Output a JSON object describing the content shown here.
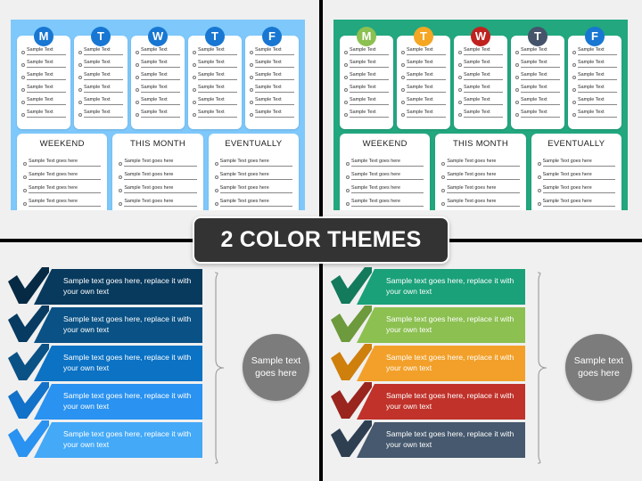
{
  "banner": {
    "title": "2 COLOR THEMES"
  },
  "theme_blue": {
    "panel_color": "#7ec8fb",
    "days": [
      {
        "letter": "M",
        "badge_color": "#1877d2",
        "tasks": [
          "Sample Text",
          "Sample Text",
          "Sample Text",
          "Sample Text",
          "Sample Text",
          "Sample Text"
        ]
      },
      {
        "letter": "T",
        "badge_color": "#1877d2",
        "tasks": [
          "Sample Text",
          "Sample Text",
          "Sample Text",
          "Sample Text",
          "Sample Text",
          "Sample Text"
        ]
      },
      {
        "letter": "W",
        "badge_color": "#1877d2",
        "tasks": [
          "Sample Text",
          "Sample Text",
          "Sample Text",
          "Sample Text",
          "Sample Text",
          "Sample Text"
        ]
      },
      {
        "letter": "T",
        "badge_color": "#1877d2",
        "tasks": [
          "Sample Text",
          "Sample Text",
          "Sample Text",
          "Sample Text",
          "Sample Text",
          "Sample Text"
        ]
      },
      {
        "letter": "F",
        "badge_color": "#1877d2",
        "tasks": [
          "Sample Text",
          "Sample Text",
          "Sample Text",
          "Sample Text",
          "Sample Text",
          "Sample Text"
        ]
      }
    ],
    "buckets": [
      {
        "title": "WEEKEND",
        "tasks": [
          "Sample Text goes here",
          "Sample Text goes here",
          "Sample Text goes here",
          "Sample Text goes here"
        ]
      },
      {
        "title": "THIS MONTH",
        "tasks": [
          "Sample Text goes here",
          "Sample Text goes here",
          "Sample Text goes here",
          "Sample Text goes here"
        ]
      },
      {
        "title": "EVENTUALLY",
        "tasks": [
          "Sample Text goes here",
          "Sample Text goes here",
          "Sample Text goes here",
          "Sample Text goes here"
        ]
      }
    ]
  },
  "theme_green": {
    "panel_color": "#22a77f",
    "days": [
      {
        "letter": "M",
        "badge_color": "#8cc051",
        "tasks": [
          "Sample Text",
          "Sample Text",
          "Sample Text",
          "Sample Text",
          "Sample Text",
          "Sample Text"
        ]
      },
      {
        "letter": "T",
        "badge_color": "#f5a623",
        "tasks": [
          "Sample Text",
          "Sample Text",
          "Sample Text",
          "Sample Text",
          "Sample Text",
          "Sample Text"
        ]
      },
      {
        "letter": "W",
        "badge_color": "#c0221f",
        "tasks": [
          "Sample Text",
          "Sample Text",
          "Sample Text",
          "Sample Text",
          "Sample Text",
          "Sample Text"
        ]
      },
      {
        "letter": "T",
        "badge_color": "#45546a",
        "tasks": [
          "Sample Text",
          "Sample Text",
          "Sample Text",
          "Sample Text",
          "Sample Text",
          "Sample Text"
        ]
      },
      {
        "letter": "F",
        "badge_color": "#1877d2",
        "tasks": [
          "Sample Text",
          "Sample Text",
          "Sample Text",
          "Sample Text",
          "Sample Text",
          "Sample Text"
        ]
      }
    ],
    "buckets": [
      {
        "title": "WEEKEND",
        "tasks": [
          "Sample Text goes here",
          "Sample Text goes here",
          "Sample Text goes here",
          "Sample Text goes here"
        ]
      },
      {
        "title": "THIS MONTH",
        "tasks": [
          "Sample Text goes here",
          "Sample Text goes here",
          "Sample Text goes here",
          "Sample Text goes here"
        ]
      },
      {
        "title": "EVENTUALLY",
        "tasks": [
          "Sample Text goes here",
          "Sample Text goes here",
          "Sample Text goes here",
          "Sample Text goes here"
        ]
      }
    ]
  },
  "arrows_blue": {
    "node_label": "Sample text goes here",
    "node_color": "#7c7c7c",
    "items": [
      {
        "text": "Sample text goes here, replace it with your own text",
        "color": "#083a5e",
        "tick_color": "#062a44"
      },
      {
        "text": "Sample text goes here, replace it with your own text",
        "color": "#0a5285",
        "tick_color": "#073b61"
      },
      {
        "text": "Sample text goes here, replace it with your own text",
        "color": "#0b72c4",
        "tick_color": "#0a5285"
      },
      {
        "text": "Sample text goes here, replace it with your own text",
        "color": "#2a92f0",
        "tick_color": "#1271c9"
      },
      {
        "text": "Sample text goes here, replace it with your own text",
        "color": "#44a9f7",
        "tick_color": "#2a92f0"
      }
    ]
  },
  "arrows_green": {
    "node_label": "Sample text goes here",
    "node_color": "#7c7c7c",
    "items": [
      {
        "text": "Sample text goes here, replace it with your own text",
        "color": "#1aa179",
        "tick_color": "#137a5c"
      },
      {
        "text": "Sample text goes here, replace it with your own text",
        "color": "#8cc051",
        "tick_color": "#6d9a3c"
      },
      {
        "text": "Sample text goes here, replace it with your own text",
        "color": "#f2a02a",
        "tick_color": "#cf7f0c"
      },
      {
        "text": "Sample text goes here, replace it with your own text",
        "color": "#c0322a",
        "tick_color": "#99251e"
      },
      {
        "text": "Sample text goes here, replace it with your own text",
        "color": "#46596e",
        "tick_color": "#2f3f52"
      }
    ]
  }
}
